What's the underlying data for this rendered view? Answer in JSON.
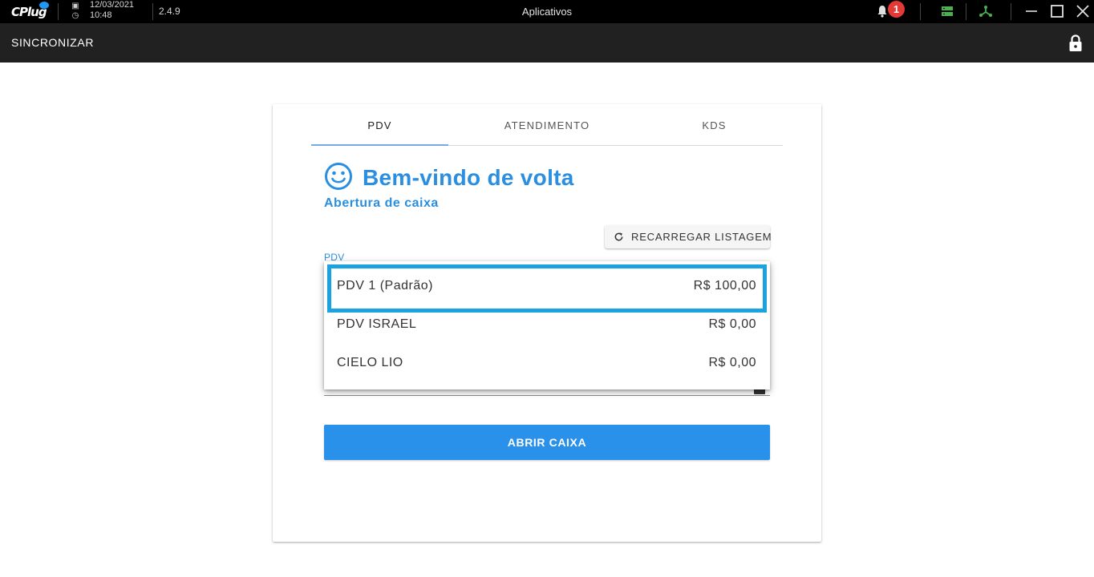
{
  "titlebar": {
    "logo_text": "CPlug",
    "date": "12/03/2021",
    "time": "10:48",
    "version": "2.4.9",
    "title": "Aplicativos",
    "notification_count": "1"
  },
  "appbar": {
    "sync_label": "SINCRONIZAR"
  },
  "tabs": [
    {
      "label": "PDV",
      "active": true
    },
    {
      "label": "ATENDIMENTO",
      "active": false
    },
    {
      "label": "KDS",
      "active": false
    }
  ],
  "welcome": {
    "title": "Bem-vindo de volta",
    "subtitle": "Abertura de caixa"
  },
  "reload_label": "RECARREGAR LISTAGEM",
  "field_label": "PDV",
  "pdv_options": [
    {
      "name": "PDV 1 (Padrão)",
      "amount": "R$ 100,00",
      "selected": true
    },
    {
      "name": "PDV ISRAEL",
      "amount": "R$ 0,00",
      "selected": false
    },
    {
      "name": "CIELO LIO",
      "amount": "R$ 0,00",
      "selected": false
    }
  ],
  "open_button_label": "ABRIR CAIXA",
  "colors": {
    "accent": "#2a8fe0",
    "button": "#2a91eb",
    "highlight": "#1aa3e0",
    "titlebar": "#000000",
    "appbar": "#212121",
    "notification": "#e53935",
    "status_green": "#4caf50"
  }
}
